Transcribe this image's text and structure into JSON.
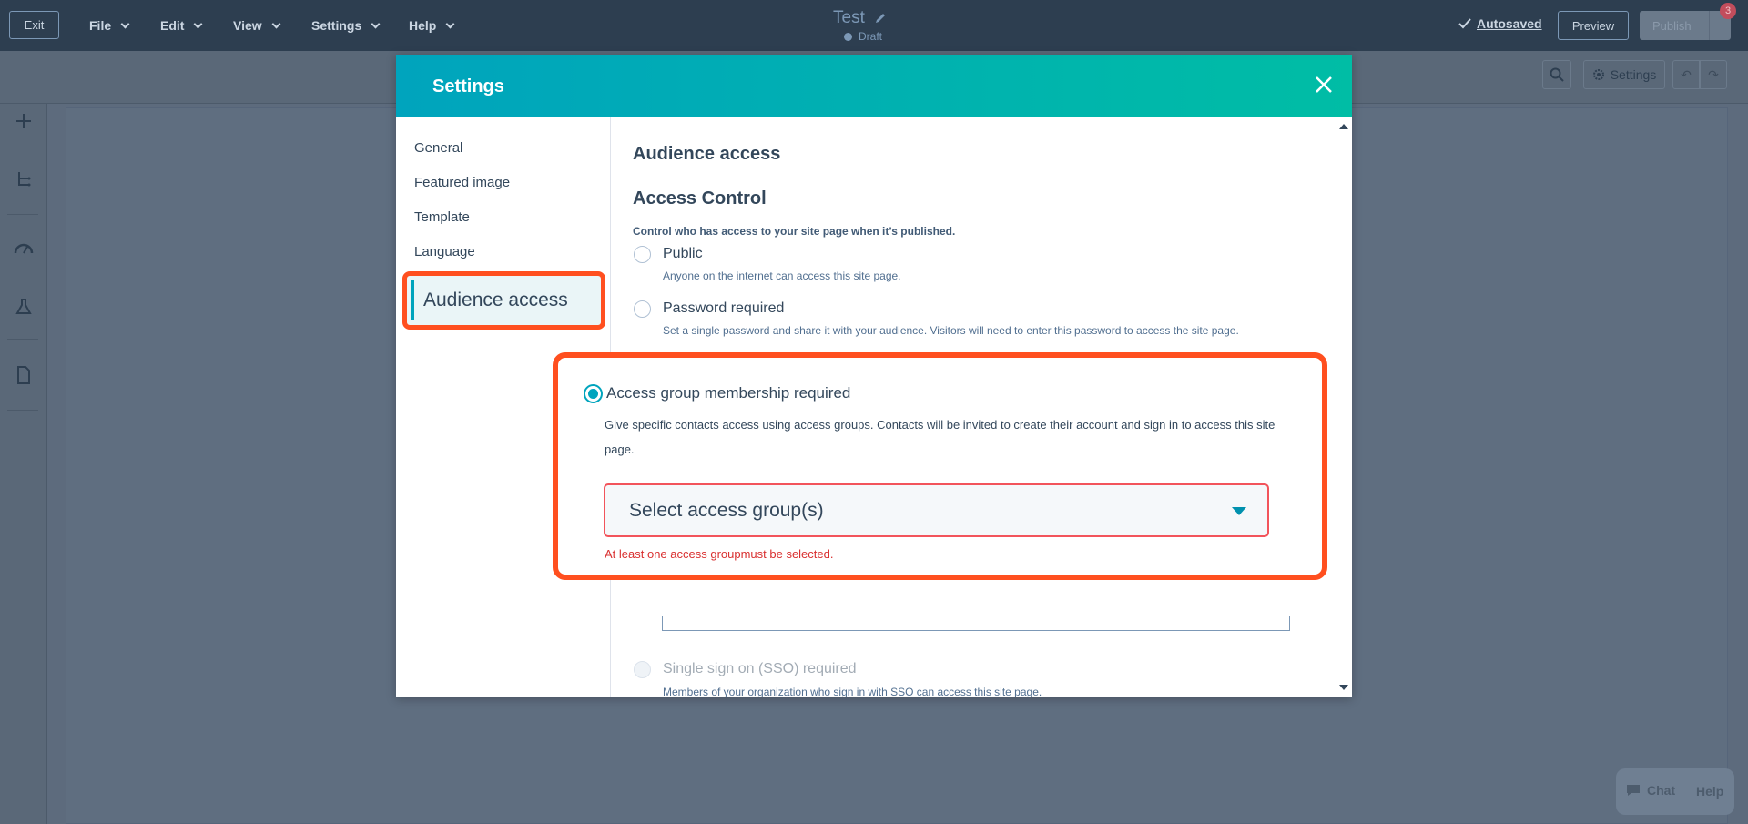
{
  "topbar": {
    "exit_label": "Exit",
    "menus": [
      "File",
      "Edit",
      "View",
      "Settings",
      "Help"
    ],
    "doc_title": "Test",
    "status": "Draft",
    "autosaved": "Autosaved",
    "preview_label": "Preview",
    "publish_label": "Publish",
    "badge_count": "3"
  },
  "subbar": {
    "settings_label": "Settings"
  },
  "modal": {
    "title": "Settings",
    "nav": [
      "General",
      "Featured image",
      "Template",
      "Language",
      "Audience access"
    ],
    "section_title": "Audience access",
    "subsection_title": "Access Control",
    "help_text": "Control who has access to your site page when it’s published.",
    "options": [
      {
        "label": "Public",
        "desc": "Anyone on the internet can access this site page."
      },
      {
        "label": "Password required",
        "desc": "Set a single password and share it with your audience. Visitors will need to enter this password to access the site page."
      },
      {
        "label": "Access group membership required",
        "desc": "Give specific contacts access using access groups. Contacts will be invited to create their account and sign in to access this site page."
      },
      {
        "label": "Single sign on (SSO) required",
        "desc": "Members of your organization who sign in with SSO can access this site page."
      }
    ],
    "select_placeholder": "Select access group(s)",
    "error_text": "At least one access groupmust be selected."
  },
  "chat": {
    "chat_label": "Chat",
    "help_label": "Help"
  }
}
